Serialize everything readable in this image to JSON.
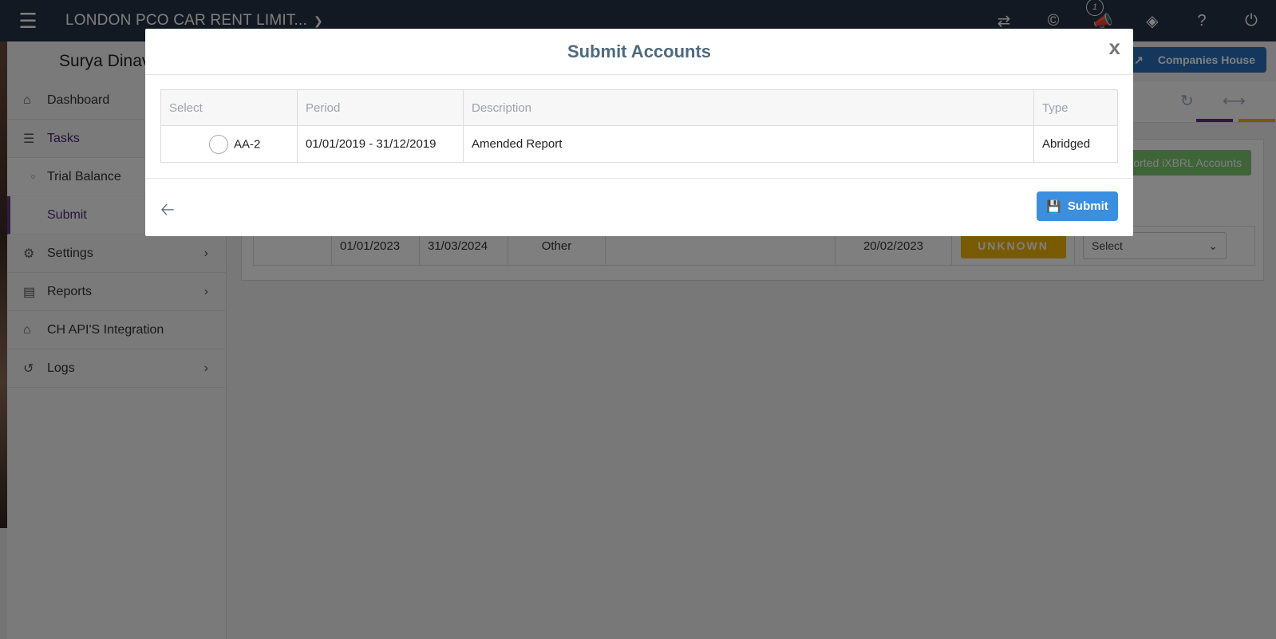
{
  "topbar": {
    "company_name": "LONDON PCO CAR RENT LIMIT...",
    "notification_count": "1"
  },
  "sidebar": {
    "user_name": "Surya Dinav",
    "items": [
      {
        "label": "Dashboard",
        "icon": "home-icon"
      },
      {
        "label": "Tasks",
        "icon": "tasks-icon"
      },
      {
        "label": "Trial Balance"
      },
      {
        "label": "Submit"
      },
      {
        "label": "Settings",
        "icon": "gear-icon"
      },
      {
        "label": "Reports",
        "icon": "document-icon"
      },
      {
        "label": "CH API'S Integration",
        "icon": "home-icon"
      },
      {
        "label": "Logs",
        "icon": "history-icon"
      }
    ]
  },
  "main": {
    "companies_house_label": "Companies House",
    "ixbrl_label": "orted iXBRL Accounts",
    "row": {
      "start": "01/01/2023",
      "end": "31/03/2024",
      "type": "Other",
      "date": "20/02/2023",
      "status": "UNKNOWN",
      "select_placeholder": "Select"
    }
  },
  "modal": {
    "title": "Submit Accounts",
    "close": "x",
    "columns": [
      "Select",
      "Period",
      "Description",
      "Type"
    ],
    "rows": [
      {
        "select": "AA-2",
        "period": "01/01/2019 - 31/12/2019",
        "description": "Amended Report",
        "type": "Abridged"
      }
    ],
    "submit_label": "Submit"
  },
  "colors": {
    "topbar": "#263244",
    "accent": "#3b8fe0",
    "title": "#4e6a80",
    "status_unknown": "#f0b400"
  }
}
